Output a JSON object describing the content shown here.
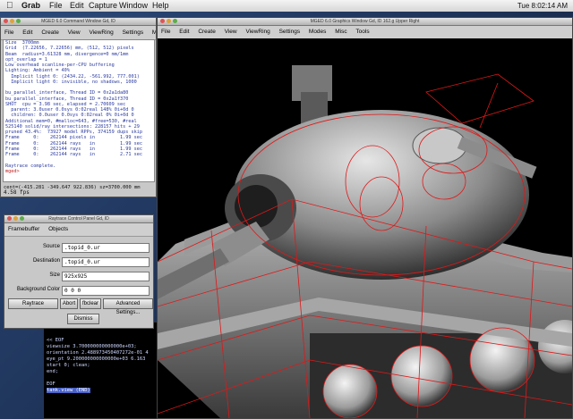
{
  "os_menubar": {
    "items": [
      "Grab",
      "File",
      "Edit",
      "Capture",
      "Window",
      "Help"
    ],
    "clock": "Tue 8:02:14 AM"
  },
  "command_window": {
    "title": "MGED 6.0 Command Window Gd, ID",
    "menu": [
      "File",
      "Edit",
      "Create",
      "View",
      "ViewRing",
      "Settings",
      "Mi"
    ],
    "log_lines": [
      "Size  3700mm",
      "Grid  (7.22656, 7.22656) mm, (512, 512) pixels",
      "Beam  radius=3.61328 mm, divergence=0 mm/1mm",
      "opt_overlap = 1",
      "Low overhead scanline-per-CPU buffering",
      "Lighting: Ambient = 40%",
      "  Implicit light 0: (2434.22, -561.992, 777.001)",
      "  Implicit light 0: invisible, no shadows, 1000",
      "",
      "bu_parallel_interface, Thread ID = 0x2a1da80",
      "bu_parallel_interface, Thread ID = 0x2a1f370",
      "SHOT  cpu = 3.98 sec, elapsed = 2.70609 sec",
      "  parent: 3.0user 0.0sys 0:02real 148% 0i+0d 0",
      "  children: 0.0user 0.0sys 0:02real 0% 0i+0d 0",
      "Additional mem=0, #malloc=643, #free=530, #real",
      "525140 solid/ray intersections: 228157 hits + 29",
      "pruned 43.4%:  73927 model RPPs, 374159 dups skip",
      "Frame     0:    262144 pixels in         1.99 sec",
      "Frame     0:    262144 rays   in         1.99 sec",
      "Frame     0:    262144 rays   in         1.99 sec",
      "Frame     0:    262144 rays   in         2.71 sec"
    ],
    "raytrace_complete": "Raytrace complete.",
    "prompt": "mged>",
    "center_line": "cent=(-415.281 -349.647 922.836) sz=3700.000 mm",
    "fps": "4.58 fps"
  },
  "terminal": {
    "lines": [
      "1 sean  staff   36",
      "",
      "<< EOF",
      "viewsize 3.700000000000000e+03;",
      "orientation 2.488973450407272e-01 4",
      "eye_pt 9.200000000000000e+03 6.163",
      "start 0; clean;",
      "end;",
      "",
      "EOF"
    ],
    "selected": "tank.view (END)"
  },
  "raytrace_panel": {
    "title": "Raytrace Control Panel Gd, ID",
    "menu": [
      "Framebuffer",
      "Objects"
    ],
    "fields": [
      {
        "label": "Source",
        "value": ".topid_0.ur"
      },
      {
        "label": "Destination",
        "value": ".topid_0.ur"
      },
      {
        "label": "Size",
        "value": "925x925"
      },
      {
        "label": "Background Color",
        "value": "0 0 0"
      }
    ],
    "buttons": {
      "raytrace": "Raytrace",
      "abort": "Abort",
      "fbclear": "fbclear",
      "advanced": "Advanced Settings...",
      "dismiss": "Dismiss"
    }
  },
  "graphics_window": {
    "title": "MGED 6.0 Graphics Window Gd, ID   162.g  Upper Right",
    "menu": [
      "File",
      "Edit",
      "Create",
      "View",
      "ViewRing",
      "Settings",
      "Modes",
      "Misc",
      "Tools"
    ]
  },
  "colors": {
    "wireframe": "#e01818",
    "metal_light": "#d8d8d8",
    "metal_dark": "#3c3c3c",
    "log_text": "#2a3aa0"
  }
}
